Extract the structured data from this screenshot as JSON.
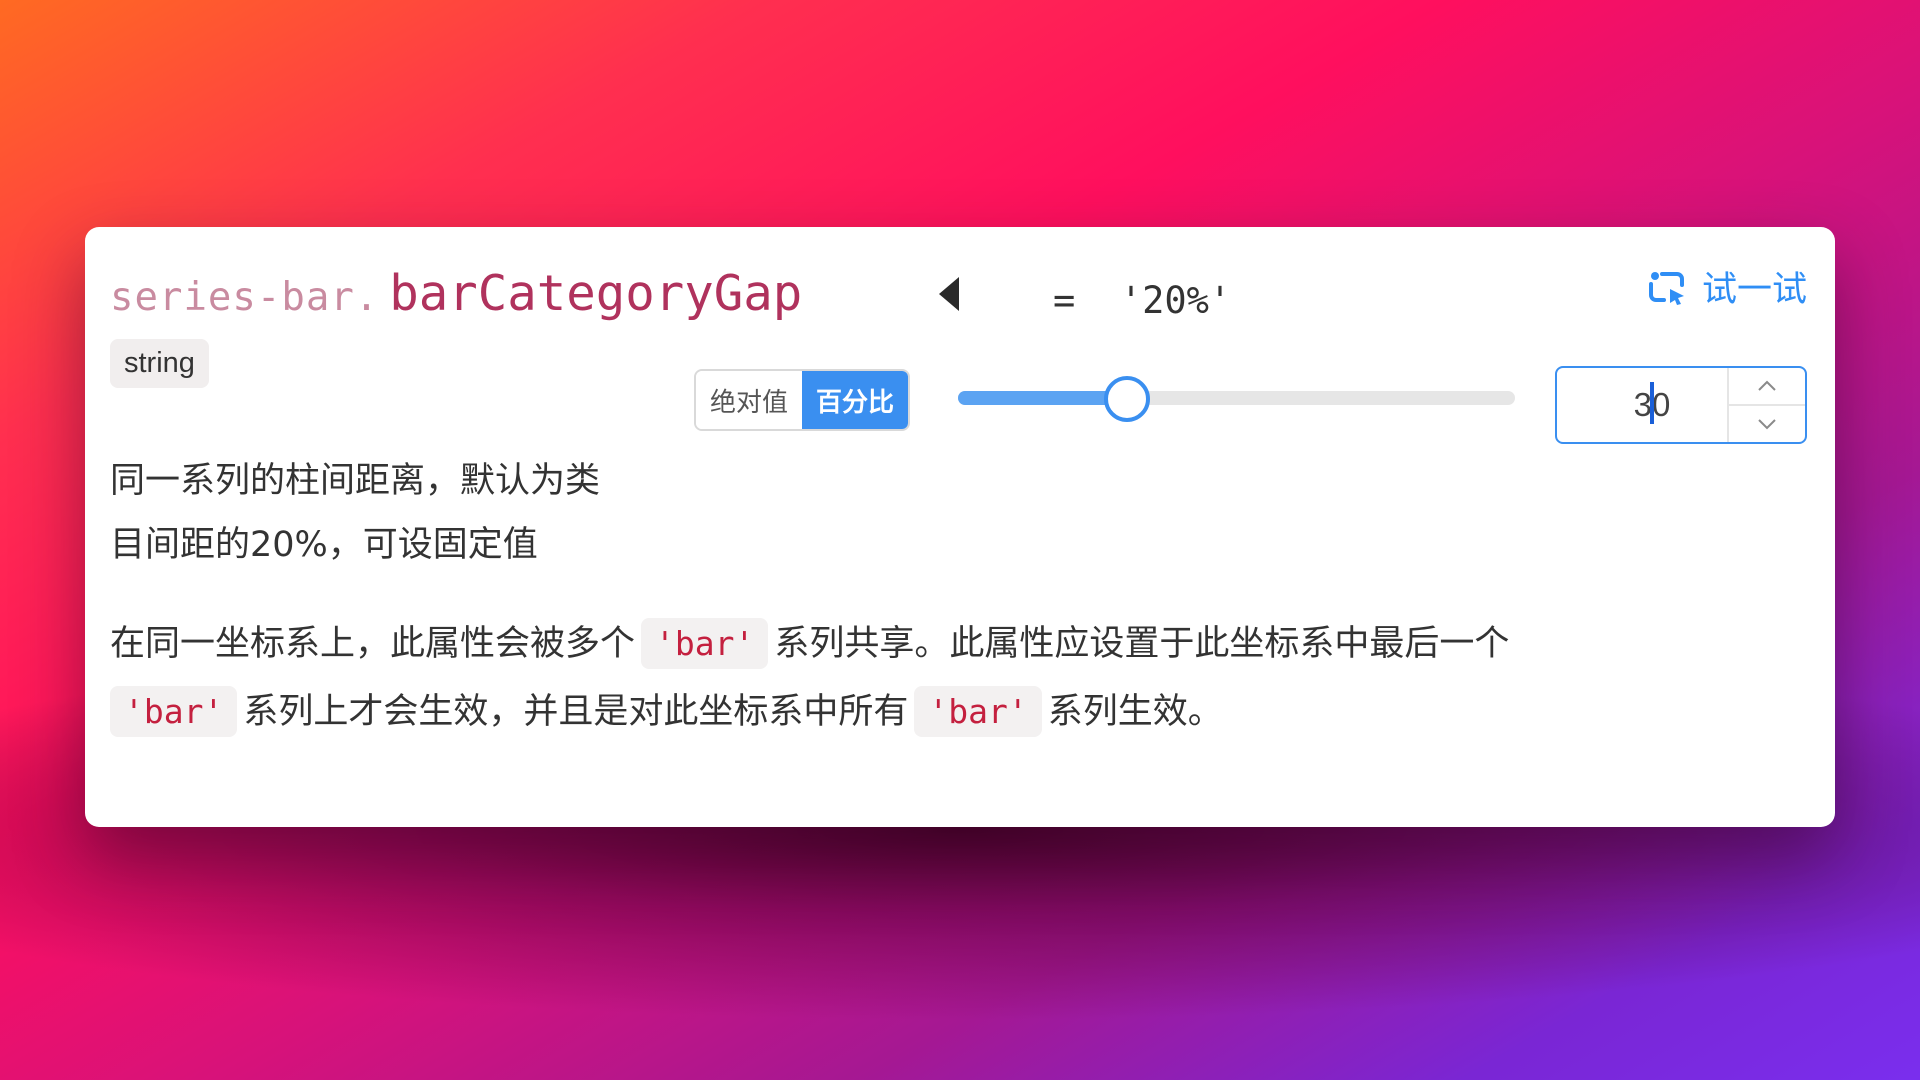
{
  "header": {
    "path_prefix": "series-bar.",
    "property_name": "barCategoryGap",
    "default_value": "=  '20%'",
    "try_label": "试一试"
  },
  "type_badge": "string",
  "controls": {
    "mode_options": [
      "绝对值",
      "百分比"
    ],
    "selected_mode": "百分比",
    "slider": {
      "min": 0,
      "max": 100,
      "value": 30
    },
    "input_value": "30"
  },
  "description": {
    "line1": "同一系列的柱间距离，默认为类",
    "line2": "目间距的20%，可设固定值"
  },
  "detail": {
    "seg1": "在同一坐标系上，此属性会被多个",
    "code1": "'bar'",
    "seg2": "系列共享。此属性应设置于此坐标系中最后一个",
    "code2": "'bar'",
    "seg3": "系列上才会生效，并且是对此坐标系中所有",
    "code3": "'bar'",
    "seg4": "系列生效。"
  },
  "colors": {
    "accent": "#3a8ff0",
    "prefix": "#c98ba0",
    "property": "#b0325d",
    "code": "#c4203f"
  },
  "icons": {
    "collapse": "caret-left-icon",
    "try": "try-refresh-icon",
    "stepper_up": "chevron-up-icon",
    "stepper_down": "chevron-down-icon"
  }
}
